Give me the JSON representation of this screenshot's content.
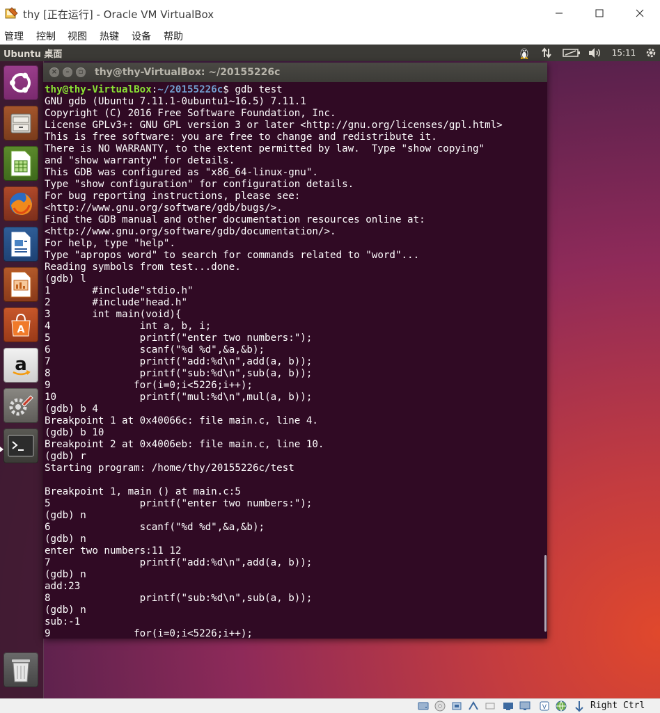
{
  "vbox": {
    "title": "thy [正在运行] - Oracle VM VirtualBox",
    "menu": [
      "管理",
      "控制",
      "视图",
      "热键",
      "设备",
      "帮助"
    ],
    "host_key": "Right Ctrl"
  },
  "ubuntu": {
    "panel_title": "Ubuntu 桌面",
    "time": "15:11",
    "launcher_items": [
      "ubuntu-dash",
      "files",
      "libreoffice-calc",
      "firefox",
      "libreoffice-writer",
      "libreoffice-impress",
      "ubuntu-software",
      "amazon",
      "system-settings",
      "terminal",
      "trash"
    ]
  },
  "terminal": {
    "title": "thy@thy-VirtualBox: ~/20155226c",
    "prompt_user": "thy@thy-VirtualBox",
    "prompt_sep": ":",
    "prompt_path": "~/20155226c",
    "prompt_cmd": "$ gdb test",
    "lines": [
      "GNU gdb (Ubuntu 7.11.1-0ubuntu1~16.5) 7.11.1",
      "Copyright (C) 2016 Free Software Foundation, Inc.",
      "License GPLv3+: GNU GPL version 3 or later <http://gnu.org/licenses/gpl.html>",
      "This is free software: you are free to change and redistribute it.",
      "There is NO WARRANTY, to the extent permitted by law.  Type \"show copying\"",
      "and \"show warranty\" for details.",
      "This GDB was configured as \"x86_64-linux-gnu\".",
      "Type \"show configuration\" for configuration details.",
      "For bug reporting instructions, please see:",
      "<http://www.gnu.org/software/gdb/bugs/>.",
      "Find the GDB manual and other documentation resources online at:",
      "<http://www.gnu.org/software/gdb/documentation/>.",
      "For help, type \"help\".",
      "Type \"apropos word\" to search for commands related to \"word\"...",
      "Reading symbols from test...done.",
      "(gdb) l",
      "1\t#include\"stdio.h\"",
      "2\t#include\"head.h\"",
      "3\tint main(void){",
      "4\t\tint a, b, i;",
      "5\t\tprintf(\"enter two numbers:\");",
      "6\t\tscanf(\"%d %d\",&a,&b);",
      "7\t\tprintf(\"add:%d\\n\",add(a, b));",
      "8\t\tprintf(\"sub:%d\\n\",sub(a, b));",
      "9\t       for(i=0;i<5226;i++);",
      "10\t\tprintf(\"mul:%d\\n\",mul(a, b));",
      "(gdb) b 4",
      "Breakpoint 1 at 0x40066c: file main.c, line 4.",
      "(gdb) b 10",
      "Breakpoint 2 at 0x4006eb: file main.c, line 10.",
      "(gdb) r",
      "Starting program: /home/thy/20155226c/test",
      "",
      "Breakpoint 1, main () at main.c:5",
      "5\t\tprintf(\"enter two numbers:\");",
      "(gdb) n",
      "6\t\tscanf(\"%d %d\",&a,&b);",
      "(gdb) n",
      "enter two numbers:11 12",
      "7\t\tprintf(\"add:%d\\n\",add(a, b));",
      "(gdb) n",
      "add:23",
      "8\t\tprintf(\"sub:%d\\n\",sub(a, b));",
      "(gdb) n",
      "sub:-1",
      "9\t       for(i=0;i<5226;i++);"
    ]
  }
}
